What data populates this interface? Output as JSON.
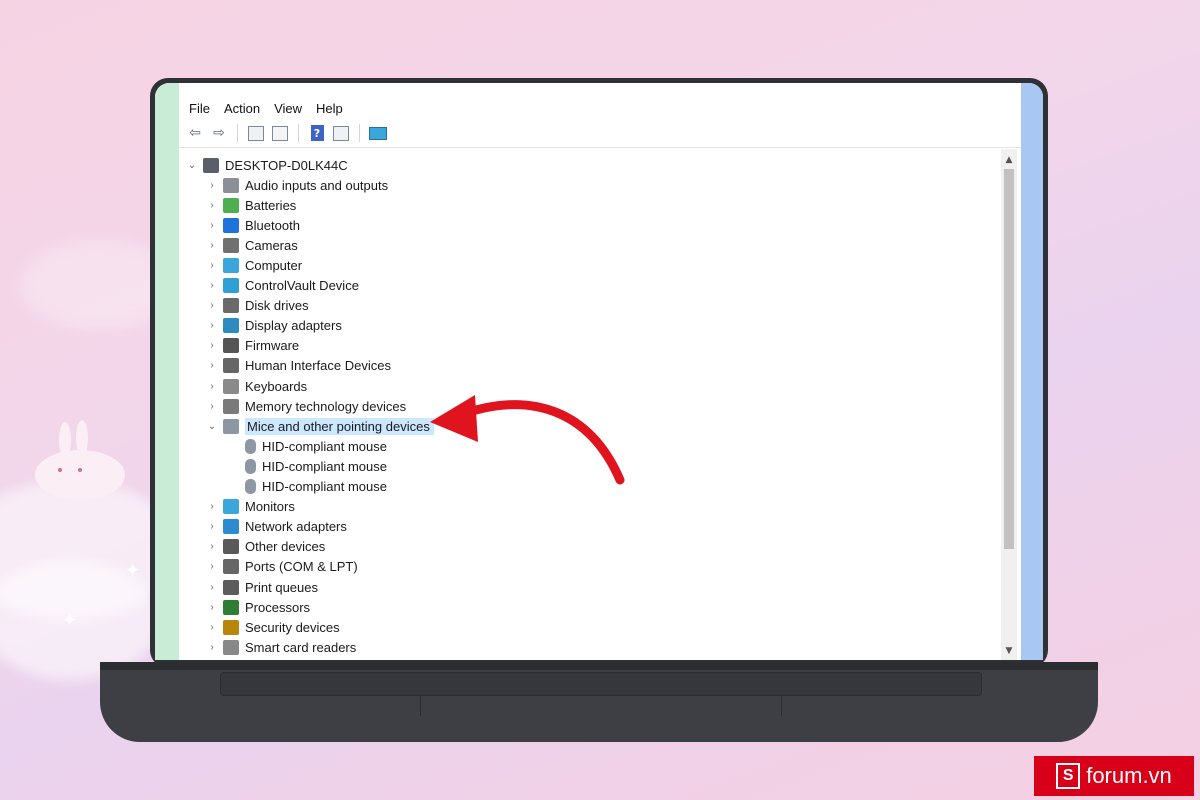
{
  "menu": [
    "File",
    "Action",
    "View",
    "Help"
  ],
  "toolbar": {
    "icons": [
      "back-arrow-icon",
      "forward-arrow-icon",
      "properties-icon",
      "document-icon",
      "help-icon",
      "details-pane-icon",
      "monitor-icon"
    ]
  },
  "tree": {
    "root": "DESKTOP-D0LK44C",
    "items": [
      {
        "label": "Audio inputs and outputs",
        "icon": "speaker-icon",
        "color": "#8a8f98"
      },
      {
        "label": "Batteries",
        "icon": "battery-icon",
        "color": "#4caf50"
      },
      {
        "label": "Bluetooth",
        "icon": "bluetooth-icon",
        "color": "#1e73d8"
      },
      {
        "label": "Cameras",
        "icon": "camera-icon",
        "color": "#707070"
      },
      {
        "label": "Computer",
        "icon": "computer-icon",
        "color": "#3aa6d9"
      },
      {
        "label": "ControlVault Device",
        "icon": "device-icon",
        "color": "#2f9fd6"
      },
      {
        "label": "Disk drives",
        "icon": "disk-icon",
        "color": "#6a6a6a"
      },
      {
        "label": "Display adapters",
        "icon": "display-adapter-icon",
        "color": "#2e8bc0"
      },
      {
        "label": "Firmware",
        "icon": "firmware-icon",
        "color": "#555555"
      },
      {
        "label": "Human Interface Devices",
        "icon": "hid-icon",
        "color": "#666666"
      },
      {
        "label": "Keyboards",
        "icon": "keyboard-icon",
        "color": "#8a8a8a"
      },
      {
        "label": "Memory technology devices",
        "icon": "memory-icon",
        "color": "#7a7a7a"
      },
      {
        "label": "Mice and other pointing devices",
        "icon": "mouse-icon",
        "color": "#8d96a3",
        "expanded": true,
        "selected": true,
        "children": [
          "HID-compliant mouse",
          "HID-compliant mouse",
          "HID-compliant mouse"
        ]
      },
      {
        "label": "Monitors",
        "icon": "monitor-icon",
        "color": "#3aa6d9"
      },
      {
        "label": "Network adapters",
        "icon": "network-icon",
        "color": "#2d8ccf"
      },
      {
        "label": "Other devices",
        "icon": "other-device-icon",
        "color": "#5a5a5a"
      },
      {
        "label": "Ports (COM & LPT)",
        "icon": "port-icon",
        "color": "#666666"
      },
      {
        "label": "Print queues",
        "icon": "printer-icon",
        "color": "#5c5c5c"
      },
      {
        "label": "Processors",
        "icon": "processor-icon",
        "color": "#2e7d32"
      },
      {
        "label": "Security devices",
        "icon": "security-icon",
        "color": "#b8860b"
      },
      {
        "label": "Smart card readers",
        "icon": "smart-card-icon",
        "color": "#888888"
      }
    ]
  },
  "annotation": {
    "arrow_color": "#e0141e"
  },
  "watermark": {
    "brand": "forum.vn",
    "letter": "S"
  }
}
